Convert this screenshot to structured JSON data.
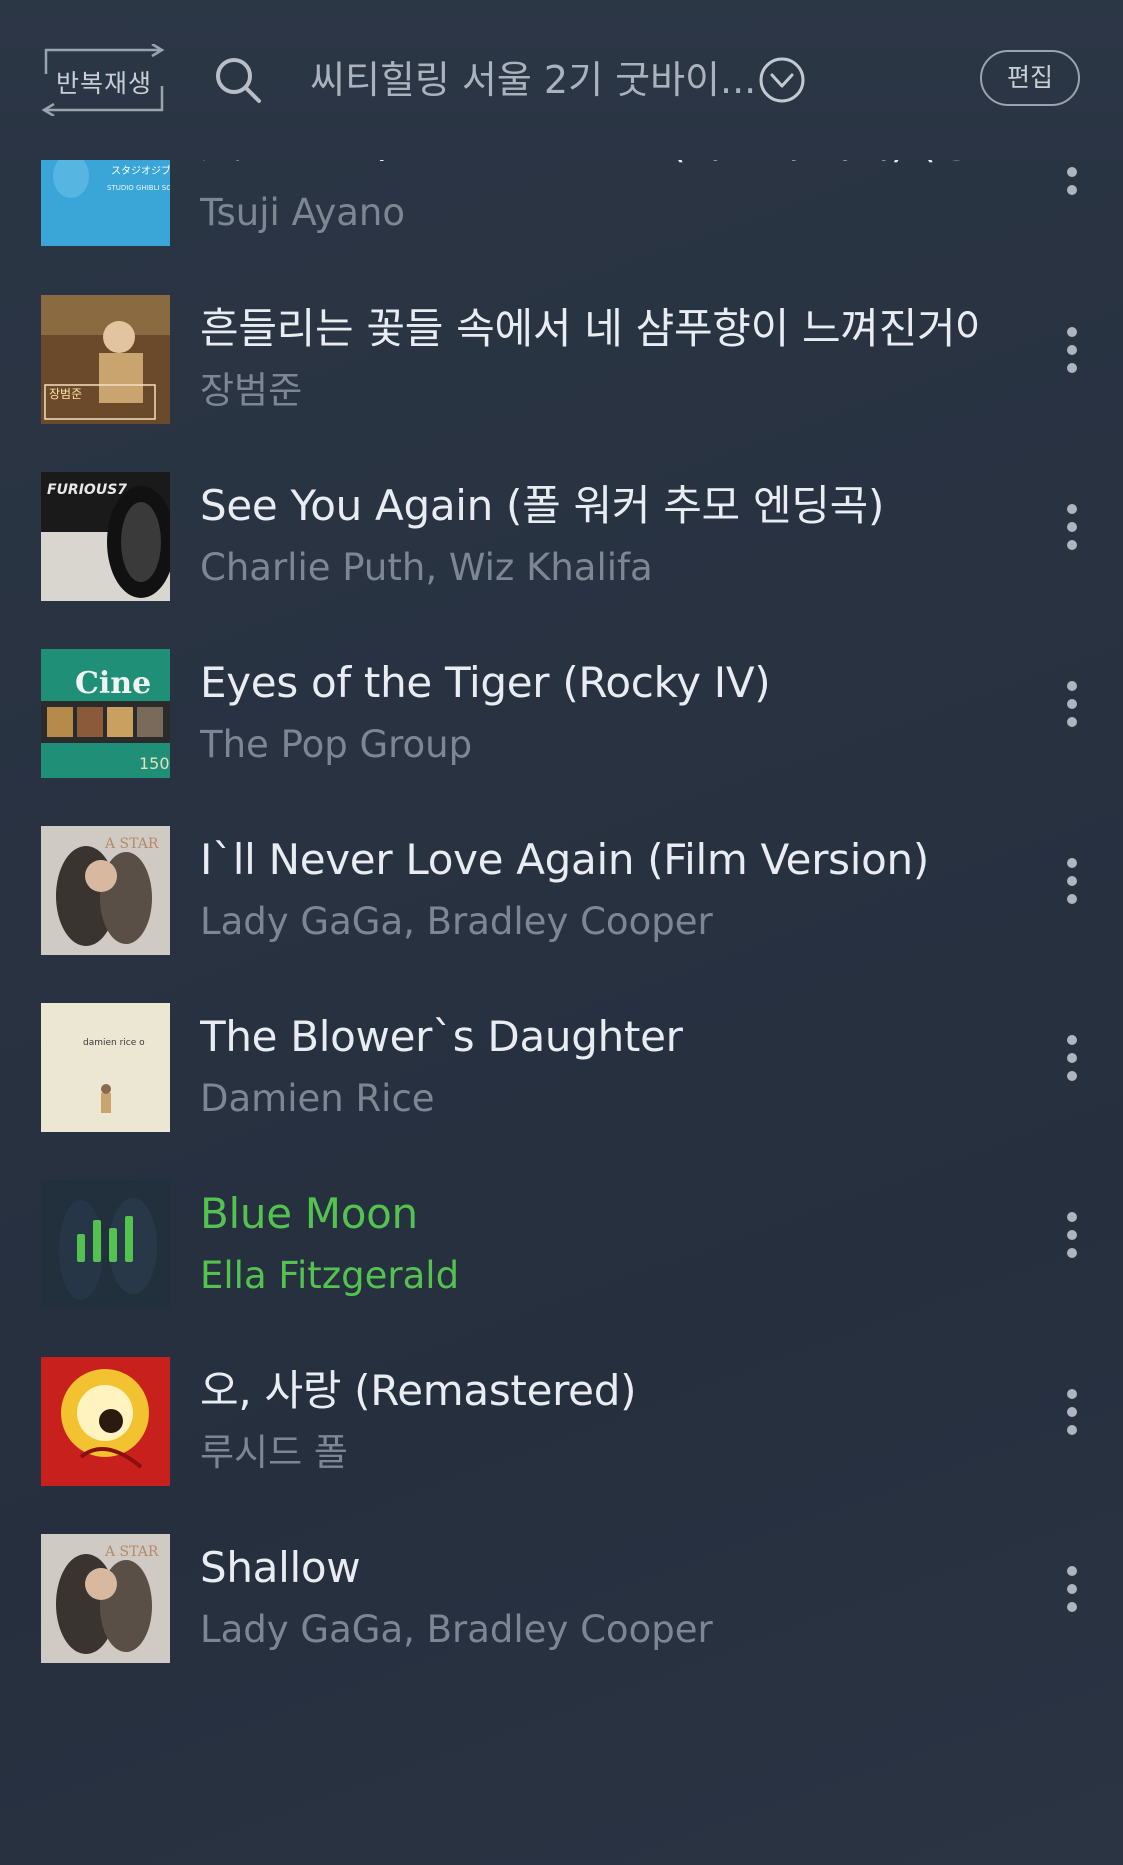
{
  "header": {
    "repeat_label": "반복재생",
    "playlist_title": "씨티힐링 서울 2기 굿바이...",
    "edit_label": "편집"
  },
  "icons": {
    "search": "search-icon",
    "dropdown": "chevron-down-circle-icon",
    "more": "more-vertical-icon",
    "equalizer": "equalizer-icon"
  },
  "colors": {
    "background": "#283241",
    "active_track": "#54c24e",
    "title": "#e9edf2",
    "artist": "#7d8794"
  },
  "tracks": [
    {
      "title": "風になる / Kazeni Naru (바람이 되어) (영...",
      "artist": "Tsuji Ayano",
      "active": false,
      "cover_text": "スタジオジブリの歌"
    },
    {
      "title": "흔들리는 꽃들 속에서 네 샴푸향이 느껴진거야",
      "artist": "장범준",
      "active": false,
      "cover_text": "장범준"
    },
    {
      "title": "See You Again (폴 워커 추모 엔딩곡)",
      "artist": "Charlie Puth, Wiz Khalifa",
      "active": false,
      "cover_text": "FURIOUS7"
    },
    {
      "title": "Eyes of the Tiger (Rocky IV)",
      "artist": "The Pop Group",
      "active": false,
      "cover_text": "Cine"
    },
    {
      "title": "I`ll Never Love Again (Film Version)",
      "artist": "Lady GaGa, Bradley Cooper",
      "active": false,
      "cover_text": ""
    },
    {
      "title": "The Blower`s Daughter",
      "artist": "Damien Rice",
      "active": false,
      "cover_text": "damien rice o"
    },
    {
      "title": "Blue Moon",
      "artist": "Ella Fitzgerald",
      "active": true,
      "cover_text": ""
    },
    {
      "title": "오, 사랑 (Remastered)",
      "artist": "루시드 폴",
      "active": false,
      "cover_text": ""
    },
    {
      "title": "Shallow",
      "artist": "Lady GaGa, Bradley Cooper",
      "active": false,
      "cover_text": ""
    }
  ]
}
